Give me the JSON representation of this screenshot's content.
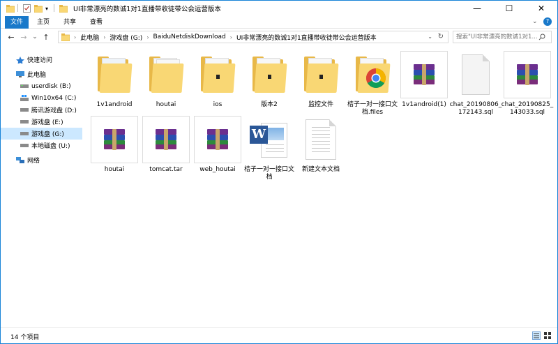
{
  "window": {
    "title": "UI非常漂亮的数诚1对1直播带收徒带公会运营版本",
    "minimize": "—",
    "maximize": "☐",
    "close": "✕"
  },
  "ribbon": {
    "tabs": [
      "文件",
      "主页",
      "共享",
      "查看"
    ]
  },
  "nav": {
    "back": "←",
    "forward": "→",
    "recent": "⌄",
    "up": "↑",
    "breadcrumb": [
      "此电脑",
      "游戏盘 (G:)",
      "BaiduNetdiskDownload",
      "UI非常漂亮的数诚1对1直播带收徒带公会运营版本"
    ],
    "refresh": "↻",
    "search_placeholder": "搜索\"UI非常漂亮的数诚1对1..."
  },
  "sidebar": {
    "items": [
      {
        "label": "快速访问",
        "icon": "star-icon"
      },
      {
        "label": "此电脑",
        "icon": "computer-icon"
      },
      {
        "label": "userdisk (B:)",
        "icon": "drive-icon"
      },
      {
        "label": "Win10x64 (C:)",
        "icon": "windows-drive-icon"
      },
      {
        "label": "腾讯游戏盘 (D:)",
        "icon": "drive-icon"
      },
      {
        "label": "游戏盘 (E:)",
        "icon": "drive-icon"
      },
      {
        "label": "游戏盘 (G:)",
        "icon": "drive-icon"
      },
      {
        "label": "本地磁盘 (U:)",
        "icon": "drive-icon"
      },
      {
        "label": "网络",
        "icon": "network-icon"
      }
    ]
  },
  "files": [
    {
      "name": "1v1android",
      "type": "folder-doc"
    },
    {
      "name": "houtai",
      "type": "folder-doc"
    },
    {
      "name": "ios",
      "type": "folder-chip"
    },
    {
      "name": "版本2",
      "type": "folder-chip"
    },
    {
      "name": "监控文件",
      "type": "folder-chip"
    },
    {
      "name": "桔子一对一接口文档.files",
      "type": "folder-chrome"
    },
    {
      "name": "1v1android(1)",
      "type": "rar"
    },
    {
      "name": "chat_20190806_172143.sql",
      "type": "blank"
    },
    {
      "name": "chat_20190825_143033.sql",
      "type": "rar"
    },
    {
      "name": "houtai",
      "type": "rar"
    },
    {
      "name": "tomcat.tar",
      "type": "rar"
    },
    {
      "name": "web_houtai",
      "type": "rar"
    },
    {
      "name": "桔子一对一接口文档",
      "type": "word"
    },
    {
      "name": "新建文本文档",
      "type": "text"
    }
  ],
  "status": {
    "count": "14 个项目"
  },
  "colors": {
    "accent": "#1979ca",
    "folder": "#f9d774",
    "selection": "#cce8ff"
  }
}
